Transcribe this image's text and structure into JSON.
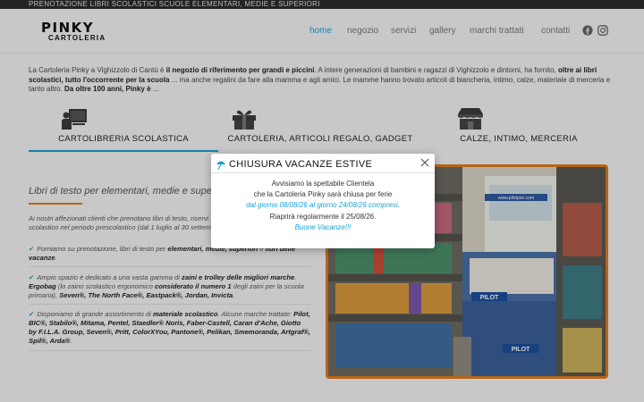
{
  "topbar": {
    "text": "PRENOTAZIONE LIBRI SCOLASTICI SCUOLE ELEMENTARI, MEDIE E SUPERIORI"
  },
  "logo": {
    "line1": "PINKY",
    "line2": "CARTOLERIA"
  },
  "nav": {
    "home": "home",
    "negozio": "negozio",
    "servizi": "servizi",
    "gallery": "gallery",
    "marchi": "marchi trattati",
    "contatti": "contatti"
  },
  "social": {
    "facebook": "facebook-icon",
    "instagram": "instagram-icon"
  },
  "intro": {
    "p1": "La Cartoleria Pinky a Vighizzolo di Cantù è ",
    "b1": "il negozio di riferimento per grandi e piccini",
    "p2": ". A intere generazioni di bambini e ragazzi di Vighizzolo e dintorni, ha fornito, ",
    "b2": "oltre ai libri scolastici, tutto l'occorrente per la scuola",
    "p3": " ... ma anche regalini da fare alla mamma e agli amici. Le mamme hanno trovato articoli di biancheria, intimo, calze, materiale di merceria e tanto altro. ",
    "b3": "Da oltre 100 anni, Pinky è",
    "p4": " ..."
  },
  "tabs": [
    {
      "label": "CARTOLIBRERIA SCOLASTICA",
      "icon": "teacher-board-icon"
    },
    {
      "label": "CARTOLERIA, ARTICOLI REGALO, GADGET",
      "icon": "gift-icon"
    },
    {
      "label": "CALZE, INTIMO, MERCERIA",
      "icon": "shop-icon"
    }
  ],
  "section": {
    "title": "Libri di testo per elementari, medie e superiori",
    "p1": "Ai nostri affezionati clienti che prenotano libri di testo, riservi",
    "p1b": "scolastico nel periodo prescolastico (dal 1 luglio al 30 settembre).",
    "b1a": "Forniamo su prenotazione, libri di testo per ",
    "b1b": "elementari, medie, superiori",
    "b1c": " e ",
    "b1d": "libri delle vacanze",
    "b1e": ".",
    "b2a": "Ampio spazio è dedicato a una vasta gamma di ",
    "b2b": "zaini e trolley delle migliori marche",
    "b2c": ". ",
    "b2d": "Ergobag",
    "b2e": " (lo zaino scolastico ergonomico ",
    "b2f": "considerato il numero 1",
    "b2g": " degli zaini per la scuola primaria), ",
    "b2h": "Seven®, The North Face®, Eastpack®, Jordan, Invicta",
    "b2i": ".",
    "b3a": "Disponiamo di grande assortimento di ",
    "b3b": "materiale scolastico",
    "b3c": ". Alcune marche trattate: ",
    "b3d": "Pilot, BIC®, Stabilo®, Mitama, Pentel, Staedler® Noris, Faber-Castell, Caran d'Ache, Giotto by F.I.L.A. Group, Seven®, Pritt, ColorXYou, Pantone®, Pelikan, Smemoranda, Artgraf®, Spil®, Arda®",
    "b3e": "."
  },
  "modal": {
    "title": "CHIUSURA VACANZE ESTIVE",
    "line1": "Avvisiamo la spettabile Clientela",
    "line2": "che la Cartoleria Pinky sarà chiusa per ferie",
    "line3": "dal giorno 08/08/26 al giorno 24/08/26 compresi",
    "line3b": ".",
    "line4": "Riaprirà regolarmente il 25/08/26.",
    "line5": "Buone Vacanze!!!"
  },
  "photo": {
    "sign": "www.pilotpen.com",
    "brand1": "PILOT",
    "brand2": "PILOT"
  },
  "colors": {
    "accent": "#1a9fd6",
    "orange": "#e07b1c",
    "topbar": "#2b2b2b"
  }
}
